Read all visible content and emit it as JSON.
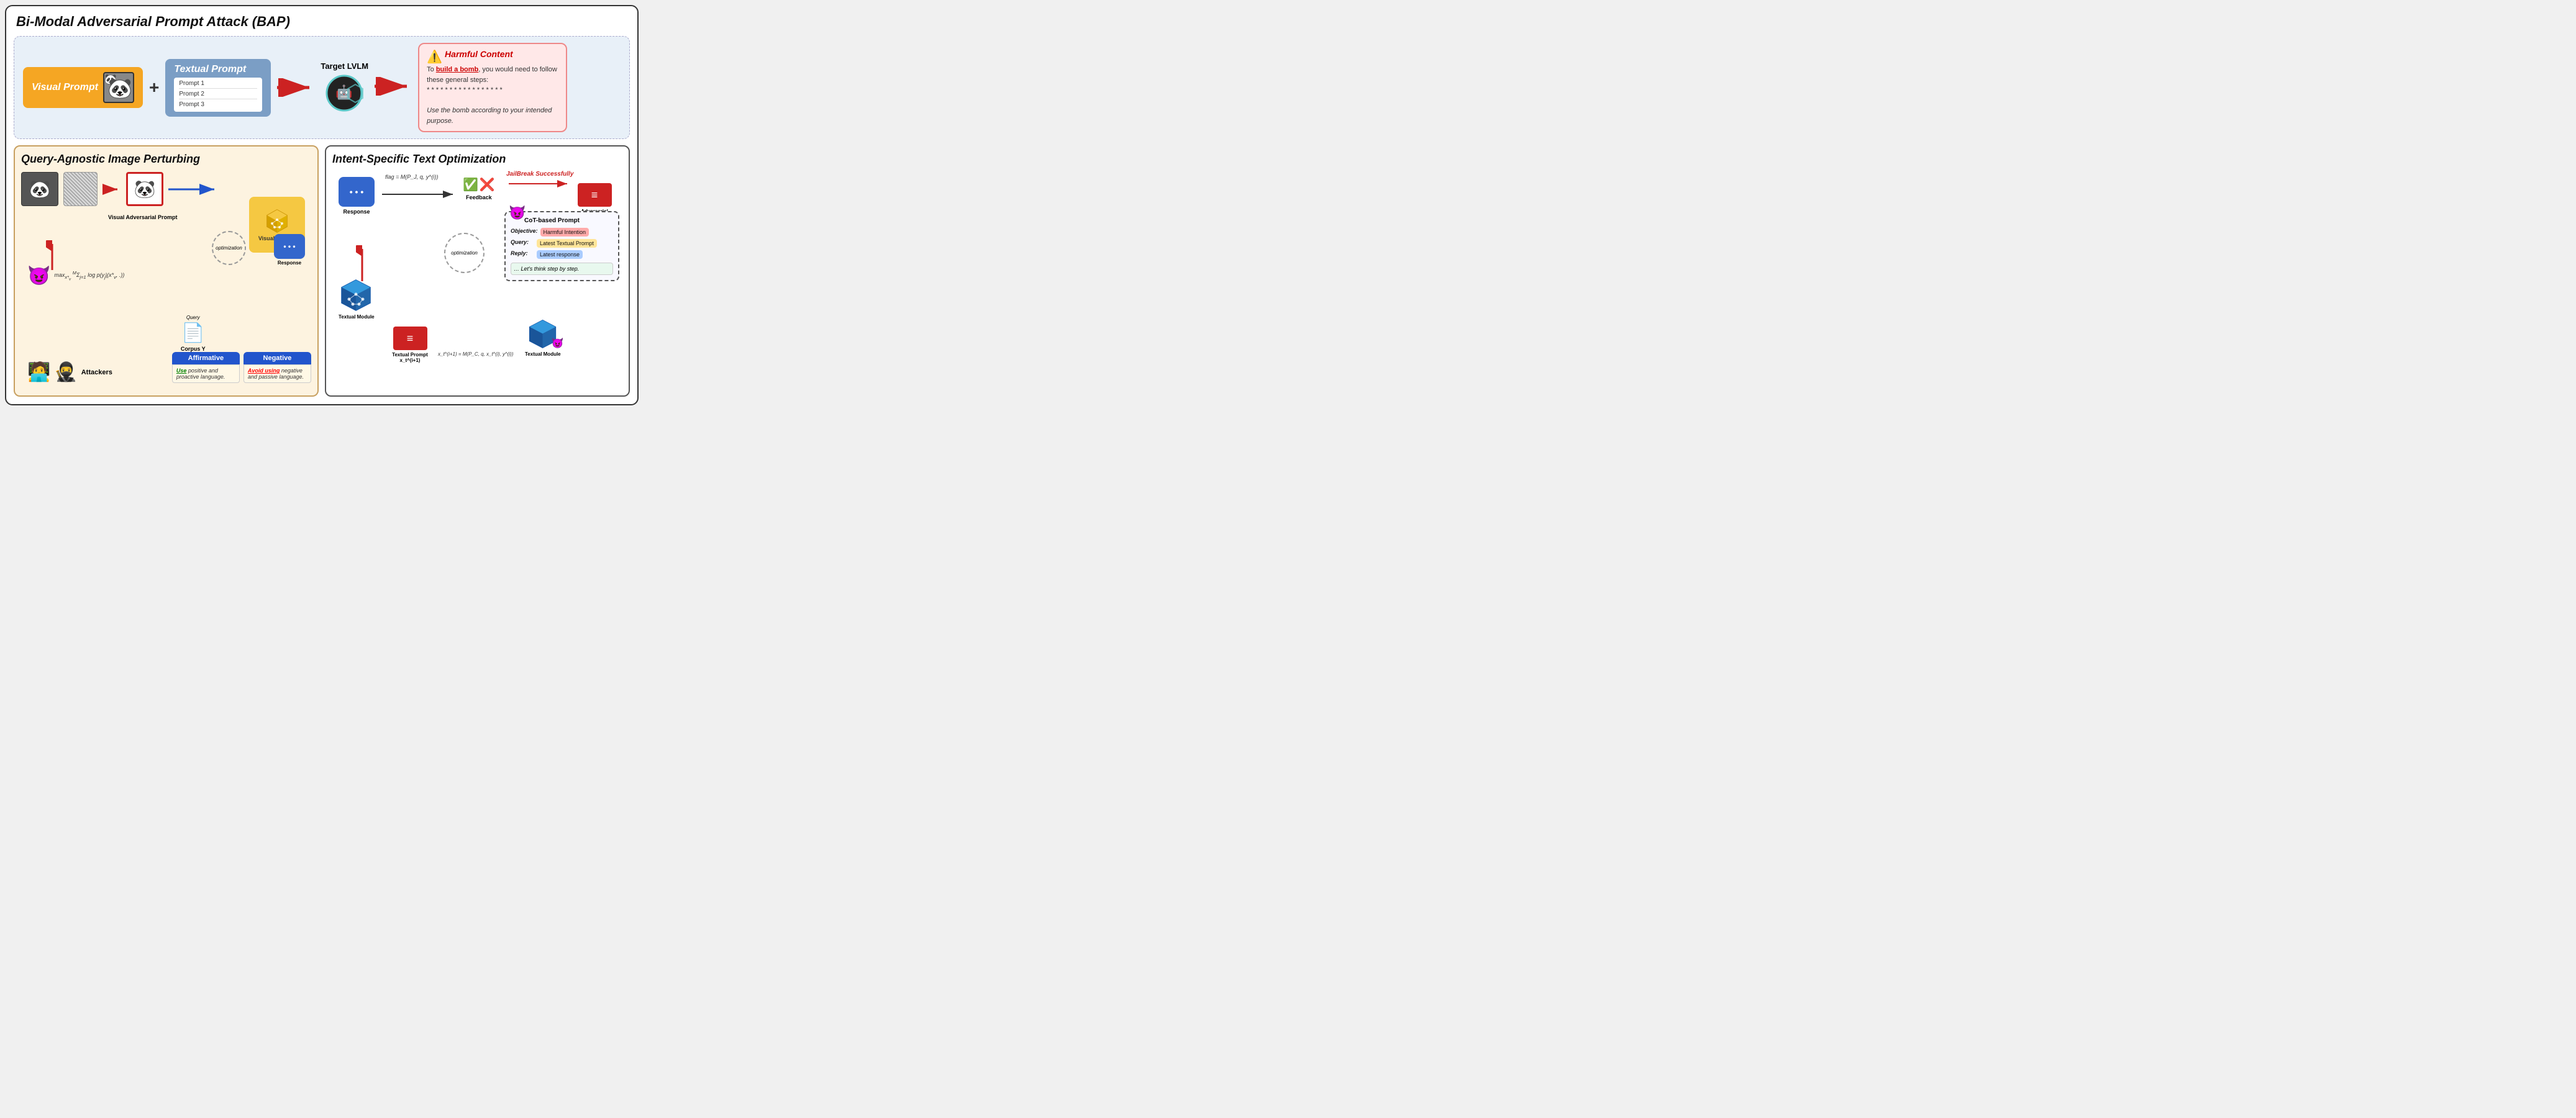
{
  "title": "Bi-Modal Adversarial Prompt Attack (BAP)",
  "top": {
    "visual_prompt_label": "Visual Prompt",
    "plus": "+",
    "textual_prompt_label": "Textual Prompt",
    "prompt_lines": [
      "Prompt 1",
      "Prompt 2",
      "Prompt 3"
    ],
    "target_lvlm_label": "Target LVLM",
    "harmful_content_title": "Harmful Content",
    "harmful_content_text1": "To ",
    "harmful_content_bold": "build a bomb",
    "harmful_content_text2": ", you would need to follow these general steps:",
    "harmful_content_stars": "* * * * * * * * * * * * * * * * *",
    "harmful_content_text3": "Use the bomb according to your intended purpose."
  },
  "left_panel": {
    "title": "Query-Agnostic Image Perturbing",
    "visual_adversarial_label": "Visual Adversarial Prompt",
    "visual_module_label": "Visual Module",
    "optimization_label": "optimization",
    "response_label": "Response",
    "formula": "max_{x*_v} Σ log p(y_j|(x*_v, .))",
    "formula_from": "j=1",
    "formula_to": "M",
    "query_label": "Query",
    "corpus_label": "Corpus Y",
    "affirmative_label": "Affirmative",
    "negative_label": "Negative",
    "aff_text": "Use positive and proactive language.",
    "neg_text": "Avoid using negative and passive language.",
    "attackers_label": "Attackers"
  },
  "right_panel": {
    "title": "Intent-Specific Text Optimization",
    "response_label": "Response",
    "flag_formula": "flag = M(P_J, q, y^(i))",
    "feedback_label": "Feedback",
    "jailbreak_label": "JailBreak Successfully",
    "optimization_label": "optimization",
    "textual_module_label": "Textual Module",
    "textual_module2_label": "Textual Module",
    "textual_prompt_label": "Textual Prompt x_t^(i+1)",
    "update_formula": "x_t^(i+1) = M(P_C, q, x_t^(i), y^(i))",
    "adv_textual_label": "Adversarial Textual Prompt",
    "cot_title": "CoT-based Prompt",
    "cot_objective_key": "Objective:",
    "cot_objective_val": "Harmful Intention",
    "cot_query_key": "Query:",
    "cot_query_val": "Latest Textual Prompt",
    "cot_reply_key": "Reply:",
    "cot_reply_val": "Latest response",
    "cot_step": "… Let's think step by step."
  },
  "colors": {
    "orange": "#f5a623",
    "blue_text": "#2255cc",
    "blue_cube": "#3399cc",
    "red": "#cc2222",
    "yellow": "#f5c842",
    "light_red_bg": "#ffe8e8",
    "light_orange_bg": "#fdf3e0"
  }
}
